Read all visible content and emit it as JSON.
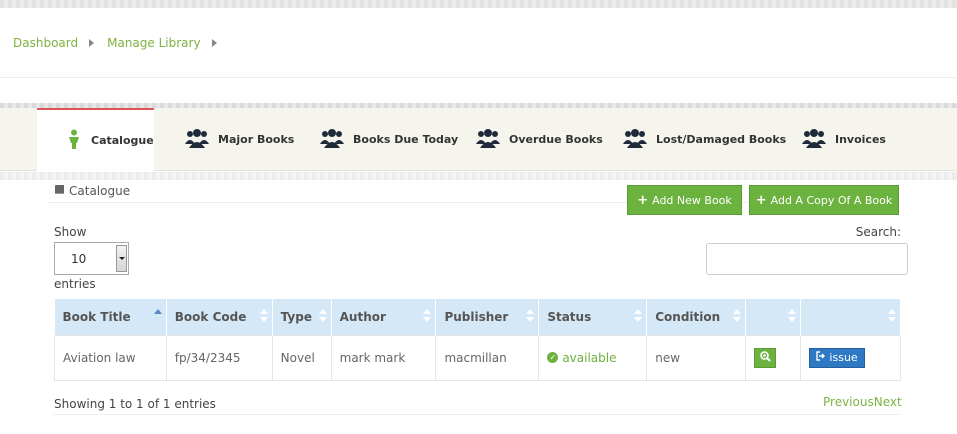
{
  "breadcrumb": [
    {
      "label": "Dashboard"
    },
    {
      "label": "Manage Library"
    }
  ],
  "tabs": [
    {
      "label": "Catalogue",
      "icon": "person-icon",
      "active": true
    },
    {
      "label": "Major Books",
      "icon": "users-icon"
    },
    {
      "label": "Books Due Today",
      "icon": "users-icon"
    },
    {
      "label": "Overdue Books",
      "icon": "users-icon"
    },
    {
      "label": "Lost/Damaged Books",
      "icon": "users-icon"
    },
    {
      "label": "Invoices",
      "icon": "users-icon"
    }
  ],
  "panel": {
    "title": "Catalogue",
    "icon": "book-icon",
    "add_new_label": "Add New Book",
    "add_copy_label": "Add A Copy Of A Book"
  },
  "length_control": {
    "show_label": "Show",
    "value": "10",
    "entries_label": "entries"
  },
  "search": {
    "label": "Search:",
    "value": ""
  },
  "table": {
    "columns": [
      "Book Title",
      "Book Code",
      "Type",
      "Author",
      "Publisher",
      "Status",
      "Condition",
      "",
      ""
    ],
    "rows": [
      {
        "title": "Aviation law",
        "code": "fp/34/2345",
        "type": "Novel",
        "author": "mark mark",
        "publisher": "macmillan",
        "status": "available",
        "condition": "new",
        "action_label": "issue"
      }
    ]
  },
  "footer": {
    "info": "Showing 1 to 1 of 1 entries",
    "previous": "Previous",
    "next": "Next"
  },
  "colors": {
    "accent_green": "#6cb23f",
    "link_green": "#7cb342",
    "issue_blue": "#2f78c4",
    "header_blue": "#d5e8f7",
    "active_tab_border": "#e05555"
  }
}
